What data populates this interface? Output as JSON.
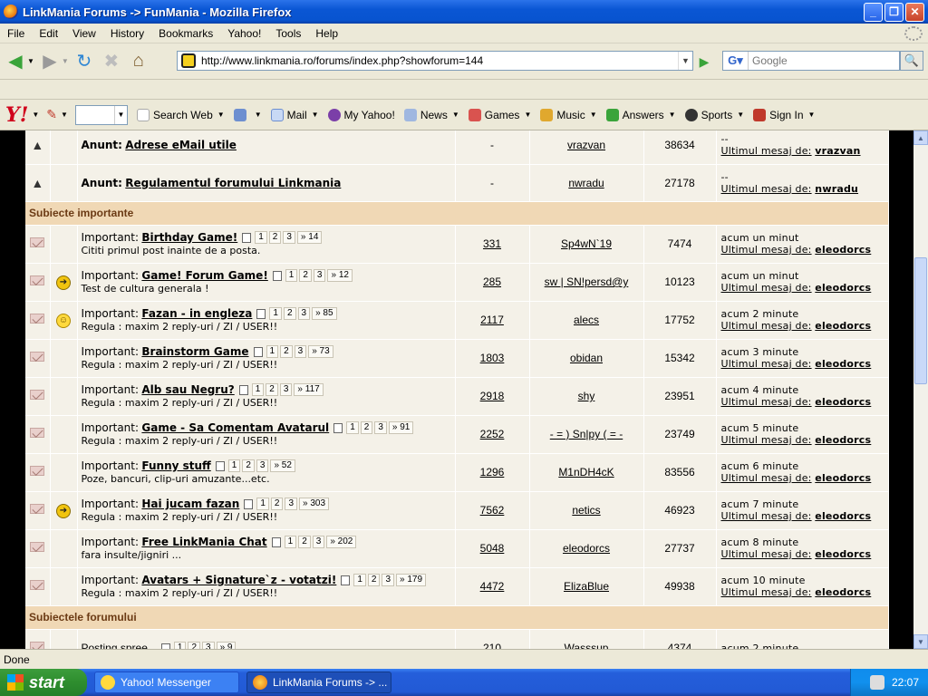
{
  "window": {
    "title": "LinkMania Forums -> FunMania - Mozilla Firefox"
  },
  "menu": [
    "File",
    "Edit",
    "View",
    "History",
    "Bookmarks",
    "Yahoo!",
    "Tools",
    "Help"
  ],
  "address": {
    "url": "http://www.linkmania.ro/forums/index.php?showforum=144"
  },
  "search": {
    "placeholder": "Google"
  },
  "yahoo_toolbar": {
    "logo": "Y!",
    "search_web": "Search Web",
    "items": [
      "Mail",
      "My Yahoo!",
      "News",
      "Games",
      "Music",
      "Answers",
      "Sports",
      "Sign In"
    ]
  },
  "announcements": [
    {
      "prefix": "Anunt:",
      "title": "Adrese eMail utile",
      "replies": "-",
      "author": "vrazvan",
      "views": "38634",
      "last_top": "--",
      "last_label": "Ultimul mesaj de:",
      "last_by": "vrazvan"
    },
    {
      "prefix": "Anunt:",
      "title": "Regulamentul forumului Linkmania",
      "replies": "-",
      "author": "nwradu",
      "views": "27178",
      "last_top": "--",
      "last_label": "Ultimul mesaj de:",
      "last_by": "nwradu"
    }
  ],
  "section_important": "Subiecte importante",
  "topics": [
    {
      "icon": "none",
      "prefix": "Important:",
      "title": "Birthday Game!",
      "pages": [
        "1",
        "2",
        "3",
        "» 14"
      ],
      "desc": "Cititi primul post inainte de a posta.",
      "replies": "331",
      "author": "Sp4wN`19",
      "views": "7474",
      "last_time": "acum un minut",
      "last_by": "eleodorcs"
    },
    {
      "icon": "arrow",
      "prefix": "Important:",
      "title": "Game! Forum Game!",
      "pages": [
        "1",
        "2",
        "3",
        "» 12"
      ],
      "desc": "Test de cultura generala !",
      "replies": "285",
      "author": "sw | SN!persd@y",
      "views": "10123",
      "last_time": "acum un minut",
      "last_by": "eleodorcs"
    },
    {
      "icon": "smile",
      "prefix": "Important:",
      "title": "Fazan - in engleza",
      "pages": [
        "1",
        "2",
        "3",
        "» 85"
      ],
      "desc": "Regula : maxim 2 reply-uri / ZI / USER!!",
      "replies": "2117",
      "author": "alecs",
      "views": "17752",
      "last_time": "acum 2 minute",
      "last_by": "eleodorcs"
    },
    {
      "icon": "none",
      "prefix": "Important:",
      "title": "Brainstorm Game",
      "pages": [
        "1",
        "2",
        "3",
        "» 73"
      ],
      "desc": "Regula : maxim 2 reply-uri / ZI / USER!!",
      "replies": "1803",
      "author": "obidan",
      "views": "15342",
      "last_time": "acum 3 minute",
      "last_by": "eleodorcs"
    },
    {
      "icon": "none",
      "prefix": "Important:",
      "title": "Alb sau Negru?",
      "pages": [
        "1",
        "2",
        "3",
        "» 117"
      ],
      "desc": "Regula : maxim 2 reply-uri / ZI / USER!!",
      "replies": "2918",
      "author": "shy",
      "views": "23951",
      "last_time": "acum 4 minute",
      "last_by": "eleodorcs"
    },
    {
      "icon": "none",
      "prefix": "Important:",
      "title": "Game - Sa Comentam Avatarul",
      "pages": [
        "1",
        "2",
        "3",
        "» 91"
      ],
      "desc": "Regula : maxim 2 reply-uri / ZI / USER!!",
      "replies": "2252",
      "author": "- = ) Sn|py ( = -",
      "views": "23749",
      "last_time": "acum 5 minute",
      "last_by": "eleodorcs"
    },
    {
      "icon": "none",
      "prefix": "Important:",
      "title": "Funny stuff",
      "pages": [
        "1",
        "2",
        "3",
        "» 52"
      ],
      "desc": "Poze, bancuri, clip-uri amuzante...etc.",
      "replies": "1296",
      "author": "M1nDH4cK",
      "views": "83556",
      "last_time": "acum 6 minute",
      "last_by": "eleodorcs"
    },
    {
      "icon": "arrow",
      "prefix": "Important:",
      "title": "Hai jucam fazan",
      "pages": [
        "1",
        "2",
        "3",
        "» 303"
      ],
      "desc": "Regula : maxim 2 reply-uri / ZI / USER!!",
      "replies": "7562",
      "author": "netics",
      "views": "46923",
      "last_time": "acum 7 minute",
      "last_by": "eleodorcs"
    },
    {
      "icon": "none",
      "prefix": "Important:",
      "title": "Free LinkMania Chat",
      "pages": [
        "1",
        "2",
        "3",
        "» 202"
      ],
      "desc": "fara insulte/jigniri ...",
      "replies": "5048",
      "author": "eleodorcs",
      "views": "27737",
      "last_time": "acum 8 minute",
      "last_by": "eleodorcs"
    },
    {
      "icon": "none",
      "prefix": "Important:",
      "title": "Avatars + Signature`z - votatzi!",
      "pages": [
        "1",
        "2",
        "3",
        "» 179"
      ],
      "desc": "Regula : maxim 2 reply-uri / ZI / USER!!",
      "replies": "4472",
      "author": "ElizaBlue",
      "views": "49938",
      "last_time": "acum 10 minute",
      "last_by": "eleodorcs"
    }
  ],
  "last_label": "Ultimul mesaj de:",
  "section_forum": "Subiectele forumului",
  "forum_topics": [
    {
      "title": "Posting spree...",
      "pages": [
        "1",
        "2",
        "3",
        "» 9"
      ],
      "replies": "210",
      "author": "Wasssup",
      "views": "4374",
      "last_time": "acum 2 minute"
    }
  ],
  "status": {
    "text": "Done"
  },
  "taskbar": {
    "start": "start",
    "tasks": [
      "Yahoo! Messenger",
      "LinkMania Forums -> ..."
    ],
    "clock": "22:07"
  }
}
